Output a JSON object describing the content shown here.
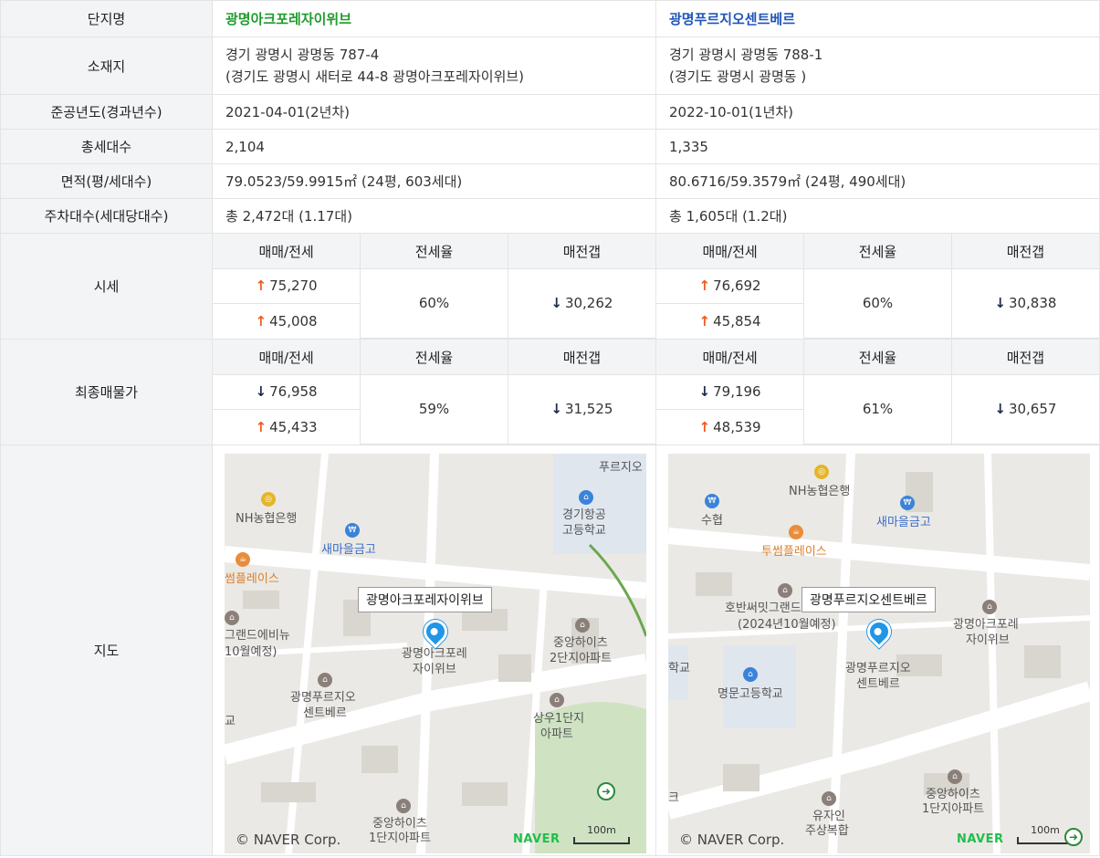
{
  "labels": {
    "name": "단지명",
    "address": "소재지",
    "built": "준공년도(경과년수)",
    "households": "총세대수",
    "area": "면적(평/세대수)",
    "parking": "주차대수(세대당대수)",
    "price": "시세",
    "listing": "최종매물가",
    "map": "지도"
  },
  "sub_headers": {
    "trade": "매매/전세",
    "ratio": "전세율",
    "gap": "매전갭"
  },
  "complex_a": {
    "name": "광명아크포레자이위브",
    "address_line1": "경기 광명시 광명동 787-4",
    "address_line2": "(경기도 광명시 새터로 44-8 광명아크포레자이위브)",
    "built": "2021-04-01(2년차)",
    "households": "2,104",
    "area": "79.0523/59.9915㎡ (24평, 603세대)",
    "parking": "총 2,472대 (1.17대)",
    "price": {
      "trade": "75,270",
      "jeonse": "45,008",
      "ratio": "60%",
      "gap": "30,262"
    },
    "listing": {
      "trade": "76,958",
      "jeonse": "45,433",
      "ratio": "59%",
      "gap": "31,525"
    },
    "map": {
      "pin_label": "광명아크포레자이위브",
      "labels": {
        "nh": "NH농협은행",
        "saemaeul": "새마을금고",
        "twosome": "썸플레이스",
        "grand": "그랜드에비뉴",
        "grand2": "10월예정)",
        "aptname1": "광명아크포레",
        "aptname2": "자이위브",
        "prugio1": "광명푸르지오",
        "prugio2": "센트베르",
        "school1": "경기항공",
        "school2": "고등학교",
        "prugio_top": "푸르지오",
        "jungang2_1": "중앙하이츠",
        "jungang2_2": "2단지아파트",
        "sangwoo1": "상우1단지",
        "sangwoo2": "아파트",
        "jungang1_1": "중앙하이츠",
        "jungang1_2": "1단지아파트",
        "edge": "교"
      },
      "copyright": "© NAVER Corp.",
      "brand": "NAVER",
      "scale": "100m"
    }
  },
  "complex_b": {
    "name": "광명푸르지오센트베르",
    "address_line1": "경기 광명시 광명동 788-1",
    "address_line2": "(경기도 광명시 광명동 )",
    "built": "2022-10-01(1년차)",
    "households": "1,335",
    "area": "80.6716/59.3579㎡ (24평, 490세대)",
    "parking": "총 1,605대 (1.2대)",
    "price": {
      "trade": "76,692",
      "jeonse": "45,854",
      "ratio": "60%",
      "gap": "30,838"
    },
    "listing": {
      "trade": "79,196",
      "jeonse": "48,539",
      "ratio": "61%",
      "gap": "30,657"
    },
    "map": {
      "pin_label": "광명푸르지오센트베르",
      "labels": {
        "nh": "NH농협은행",
        "suhyeop": "수협",
        "saemaeul": "새마을금고",
        "twosome": "투썸플레이스",
        "hoban1": "호반써밋그랜드",
        "hoban2": "(2024년10월예정)",
        "arkfore1": "광명아크포레",
        "arkfore2": "자이위브",
        "school": "명문고등학교",
        "aptname1": "광명푸르지오",
        "aptname2": "센트베르",
        "jungang1": "중앙하이츠",
        "jungang2": "1단지아파트",
        "yujain1": "유자인",
        "yujain2": "주상복합",
        "edge1": "학교",
        "edge2": "크"
      },
      "copyright": "© NAVER Corp.",
      "brand": "NAVER",
      "scale": "100m"
    }
  },
  "colors": {
    "up": "#f05a1e",
    "down": "#1c2b4a",
    "name_a": "#1f9b2c",
    "name_b": "#1f55b8",
    "label_bg": "#f3f4f5"
  },
  "icons": {
    "up": "arrow-up-icon",
    "down": "arrow-down-icon"
  }
}
